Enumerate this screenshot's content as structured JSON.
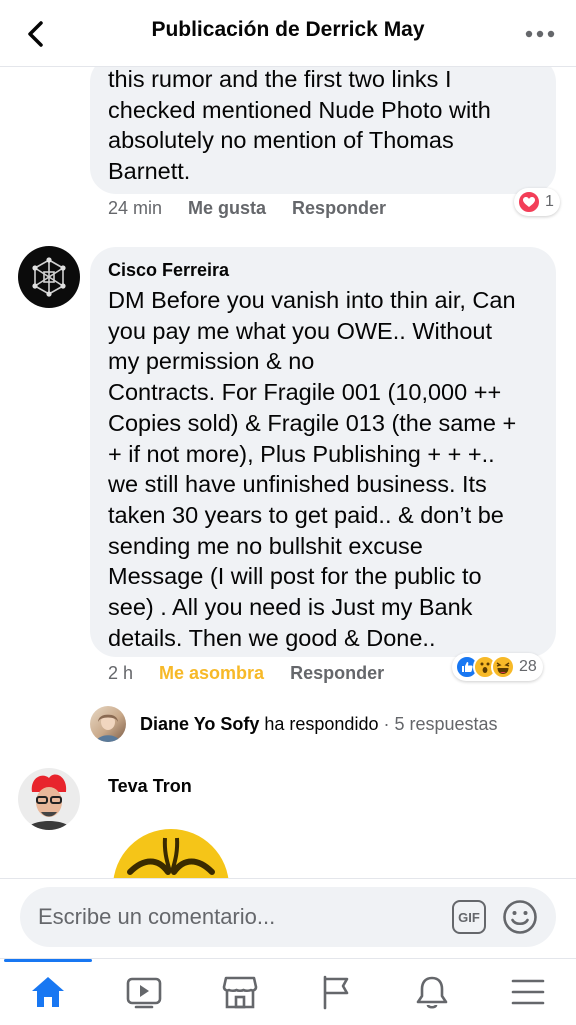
{
  "header": {
    "title": "Publicación de Derrick May"
  },
  "comments": [
    {
      "text": "this rumor and the first two links I\nchecked mentioned Nude Photo with\nabsolutely no mention of Thomas\nBarnett.",
      "time": "24 min",
      "like_label": "Me gusta",
      "reply_label": "Responder",
      "reaction_count": "1"
    },
    {
      "author": "Cisco Ferreira",
      "text": "DM Before you vanish into thin air, Can\nyou pay me what you OWE.. Without\nmy permission & no\nContracts. For Fragile 001 (10,000 ++\nCopies sold) & Fragile 013 (the same +\n+ if not more), Plus Publishing + + +..\nwe still have unfinished business. Its\ntaken 30 years to get paid.. & don’t be\nsending me no bullshit excuse\nMessage (I will post for the public to\nsee) . All you need is Just my Bank\ndetails. Then we good & Done..",
      "time": "2 h",
      "reaction_label": "Me asombra",
      "reply_label": "Responder",
      "reaction_count": "28",
      "replies": {
        "name": "Diane Yo Sofy",
        "action": " ha respondido",
        "count": " · 5 respuestas"
      }
    },
    {
      "author": "Teva Tron"
    }
  ],
  "composer": {
    "placeholder": "Escribe un comentario...",
    "gif_label": "GIF"
  },
  "colors": {
    "accent": "#1877f2",
    "bubble": "#f0f2f5",
    "wow": "#f7b928",
    "love": "#f33e58"
  }
}
